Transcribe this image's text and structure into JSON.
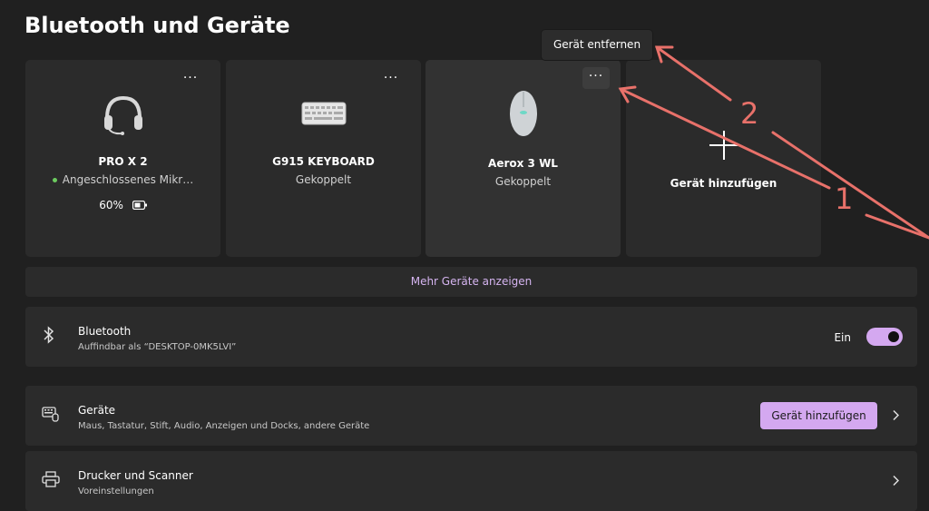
{
  "page": {
    "title": "Bluetooth und Geräte"
  },
  "devices": [
    {
      "name": "PRO X 2",
      "status": "Angeschlossenes Mikr…",
      "battery": "60%",
      "icon": "headset-icon"
    },
    {
      "name": "G915 KEYBOARD",
      "status": "Gekoppelt",
      "icon": "keyboard-icon"
    },
    {
      "name": "Aerox 3 WL",
      "status": "Gekoppelt",
      "icon": "mouse-icon"
    }
  ],
  "add_card": {
    "label": "Gerät hinzufügen"
  },
  "more_glyph": "···",
  "tooltip": {
    "text": "Gerät entfernen"
  },
  "more_devices": {
    "label": "Mehr Geräte anzeigen"
  },
  "bluetooth": {
    "title": "Bluetooth",
    "subtitle": "Auffindbar als “DESKTOP-0MK5LVI”",
    "toggle_label": "Ein",
    "enabled": true
  },
  "geraete": {
    "title": "Geräte",
    "subtitle": "Maus, Tastatur, Stift, Audio, Anzeigen und Docks, andere Geräte",
    "button": "Gerät hinzufügen"
  },
  "drucker": {
    "title": "Drucker und Scanner",
    "subtitle": "Voreinstellungen"
  },
  "annotations": {
    "one": "1",
    "two": "2"
  },
  "colors": {
    "accent": "#d4a8f0",
    "annotation": "#e8716a",
    "background": "#202020",
    "card": "#2b2b2b"
  }
}
